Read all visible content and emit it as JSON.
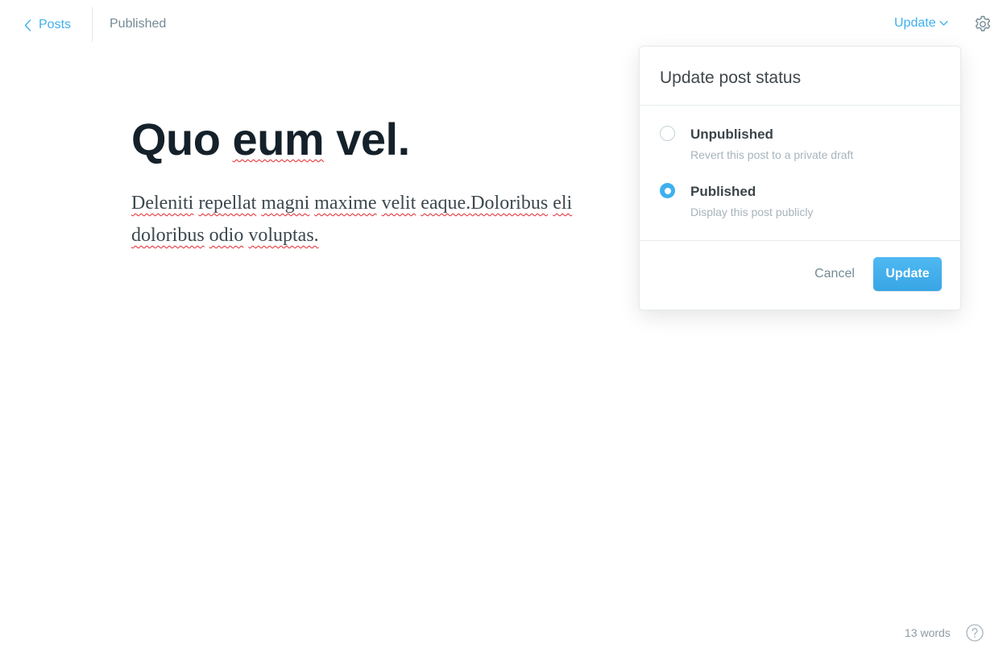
{
  "header": {
    "back_label": "Posts",
    "status": "Published",
    "update_label": "Update",
    "back_icon": "chevron-left-icon",
    "update_icon": "chevron-down-icon",
    "settings_icon": "gear-icon"
  },
  "post": {
    "title_words": [
      "Quo",
      "eum",
      "vel."
    ],
    "body_line_1": [
      "Deleniti",
      "repellat",
      "magni",
      "maxime",
      "velit",
      "eaque.Doloribus",
      "eli"
    ],
    "body_line_2": [
      "doloribus",
      "odio",
      "voluptas."
    ]
  },
  "popover": {
    "title": "Update post status",
    "options": [
      {
        "label": "Unpublished",
        "description": "Revert this post to a private draft",
        "selected": false
      },
      {
        "label": "Published",
        "description": "Display this post publicly",
        "selected": true
      }
    ],
    "cancel_label": "Cancel",
    "update_label": "Update"
  },
  "footer": {
    "word_count": "13 words",
    "help_icon": "help-circle-icon"
  },
  "colors": {
    "accent": "#3eb0ef",
    "text": "#15212a",
    "muted": "#738a94",
    "spellcheck": "#e0262d"
  }
}
